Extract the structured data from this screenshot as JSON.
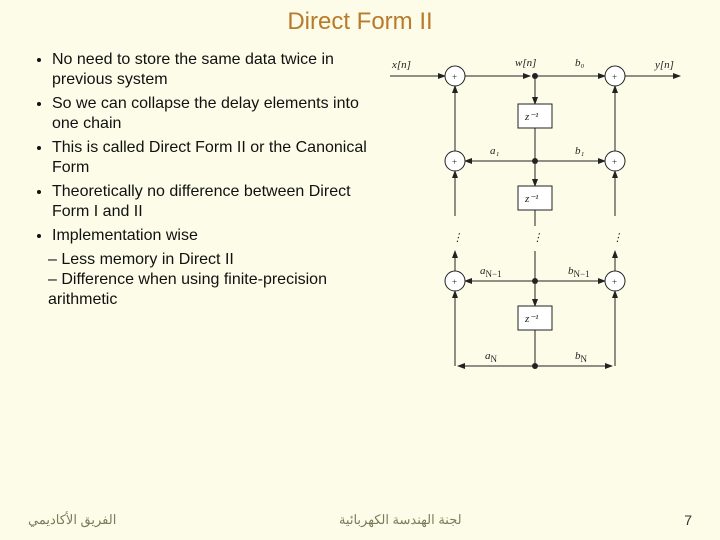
{
  "title": "Direct Form II",
  "bullets": {
    "b0": "No need to store the same data twice in previous system",
    "b1": "So we can collapse the delay elements into one chain",
    "b2": "This is called Direct Form II or the Canonical Form",
    "b3": "Theoretically no difference between Direct Form I and II",
    "b4": "Implementation wise",
    "s0": "Less memory in Direct II",
    "s1": "Difference when using finite-precision arithmetic"
  },
  "diagram": {
    "input": "x[n]",
    "mid": "w[n]",
    "output": "y[n]",
    "delay": "z⁻¹",
    "plus": "+",
    "a_left": {
      "a1": "a₁",
      "aNm1": "a_{N-1}",
      "aN": "a_N"
    },
    "b_right": {
      "b0": "b₀",
      "b1": "b₁",
      "bNm1": "b_{N-1}",
      "bN": "b_N"
    }
  },
  "footer": {
    "left": "الفريق الأكاديمي",
    "center": "لجنة الهندسة الكهربائية",
    "page": "7"
  }
}
